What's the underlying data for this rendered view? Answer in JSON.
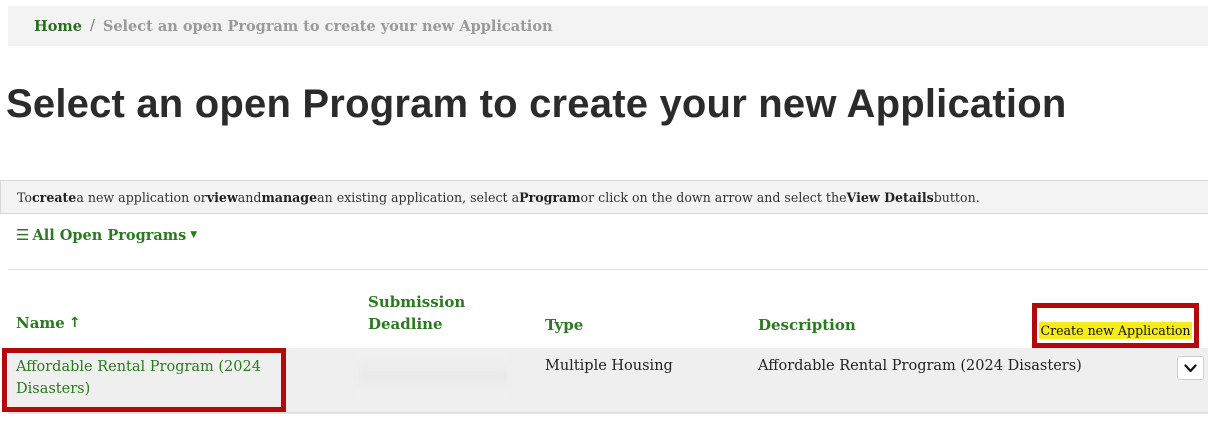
{
  "breadcrumb": {
    "home": "Home",
    "separator": "/",
    "current": "Select an open Program to create your new Application"
  },
  "page_title": "Select an open Program to create your new Application",
  "info": {
    "t1": "To ",
    "b1": "create",
    "t2": " a new application or ",
    "b2": "view",
    "t3": " and ",
    "b3": "manage",
    "t4": " an existing application, select a ",
    "b4": "Program",
    "t5": " or click on the down arrow and select the ",
    "b5": "View Details",
    "t6": " button."
  },
  "filter": {
    "label": "All Open Programs",
    "icon": "list-icon"
  },
  "table": {
    "headers": {
      "name": "Name",
      "deadline_line1": "Submission",
      "deadline_line2": "Deadline",
      "type": "Type",
      "description": "Description"
    },
    "create_button": "Create new Application",
    "rows": [
      {
        "name": "Affordable Rental Program (2024 Disasters)",
        "type": "Multiple Housing",
        "description": "Affordable Rental Program (2024 Disasters)"
      }
    ]
  },
  "colors": {
    "link_green": "#2a7a1f",
    "highlight_red": "#b10a0a",
    "button_yellow": "#f7ec18"
  }
}
